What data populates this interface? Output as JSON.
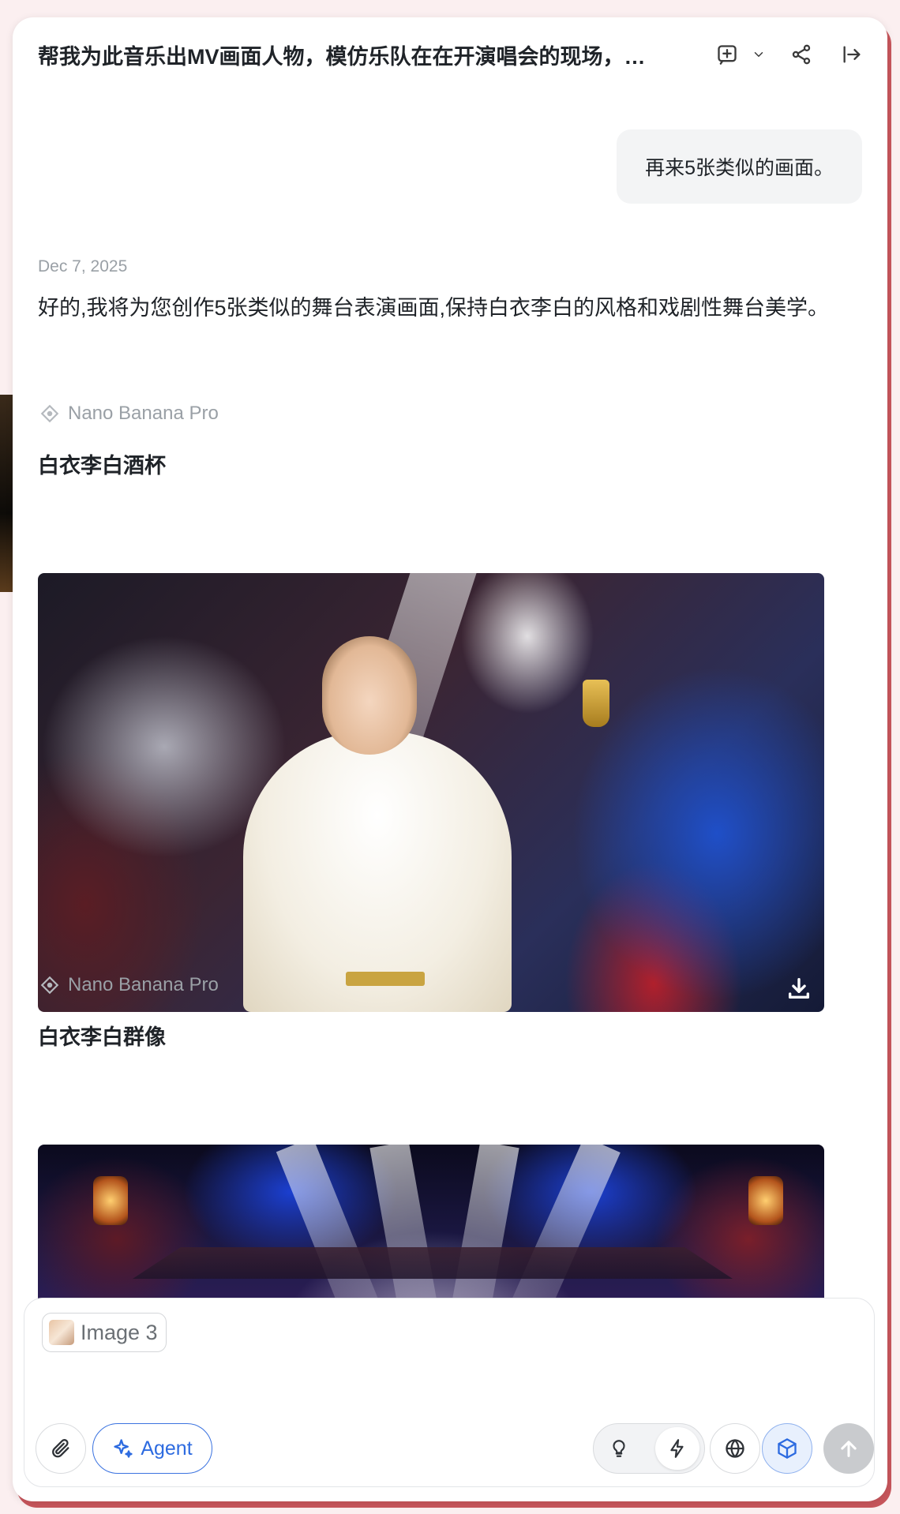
{
  "header": {
    "title": "帮我为此音乐出MV画面人物，模仿乐队在在开演唱会的现场，…",
    "icons": [
      "new-chat-icon",
      "chevron-down-icon",
      "share-icon",
      "sidebar-exit-icon"
    ]
  },
  "conversation": {
    "user_message": "再来5张类似的画面。",
    "date": "Dec 7, 2025",
    "assistant_text": "好的,我将为您创作5张类似的舞台表演画面,保持白衣李白的风格和戏剧性舞台美学。",
    "images": [
      {
        "model": "Nano Banana Pro",
        "title": "白衣李白酒杯"
      },
      {
        "model": "Nano Banana Pro",
        "title": "白衣李白群像"
      }
    ]
  },
  "composer": {
    "attachment_label": "Image 3",
    "agent_label": "Agent",
    "tools": [
      "paperclip-icon",
      "sparkle-icon",
      "lightbulb-icon",
      "lightning-icon",
      "globe-icon",
      "cube-icon",
      "send-arrow-icon"
    ]
  },
  "colors": {
    "accent_blue": "#2d6be0",
    "send_disabled": "#c9cbce",
    "frame_accent": "#c8565c"
  }
}
